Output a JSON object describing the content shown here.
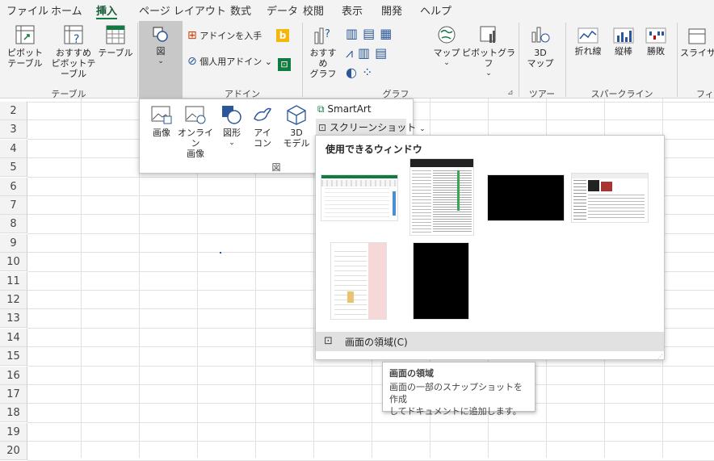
{
  "tabs": [
    "ファイル",
    "ホーム",
    "挿入",
    "ページ レイアウト",
    "数式",
    "データ",
    "校閲",
    "表示",
    "開発",
    "ヘルプ"
  ],
  "ribbon": {
    "pivot": [
      "ピボット",
      "テーブル"
    ],
    "recommended_pivot": [
      "おすすめ",
      "ピボットテーブル"
    ],
    "table": "テーブル",
    "group_table": "テーブル",
    "figure": "図",
    "get_addins": "アドインを入手",
    "my_addins": "個人用アドイン",
    "group_addin": "アドイン",
    "recommended_chart": [
      "おすすめ",
      "グラフ"
    ],
    "map": "マップ",
    "pivot_chart": "ピボットグラフ",
    "group_chart": "グラフ",
    "map3d": [
      "3D",
      "マップ"
    ],
    "group_tour": "ツアー",
    "spark_line": "折れ線",
    "spark_column": "縦棒",
    "spark_winloss": "勝敗",
    "group_sparkline": "スパークライン",
    "slicer": "スライサ",
    "group_filter": "フィ"
  },
  "rows": [
    "2",
    "3",
    "4",
    "5",
    "6",
    "7",
    "8",
    "9",
    "10",
    "11",
    "12",
    "13",
    "14",
    "15",
    "16",
    "17",
    "18",
    "19",
    "20"
  ],
  "figure_menu": {
    "image": "画像",
    "online_image": [
      "オンライン",
      "画像"
    ],
    "shapes": "図形",
    "icons": [
      "アイ",
      "コン"
    ],
    "model3d": [
      "3D",
      "モデル"
    ],
    "smartart": "SmartArt",
    "screenshot": "スクリーンショット",
    "group_label": "図"
  },
  "screenshot_menu": {
    "header": "使用できるウィンドウ",
    "clip_label": "画面の領域(C)"
  },
  "tooltip": {
    "title": "画面の領域",
    "line1": "画面の一部のスナップショットを作成",
    "line2": "してドキュメントに追加します。"
  },
  "colors": {
    "excel_green": "#107c41",
    "ribbon_bg": "#f3f3f3",
    "selected_bg": "#c8c8c8",
    "hover_bg": "#e5e5e5"
  }
}
